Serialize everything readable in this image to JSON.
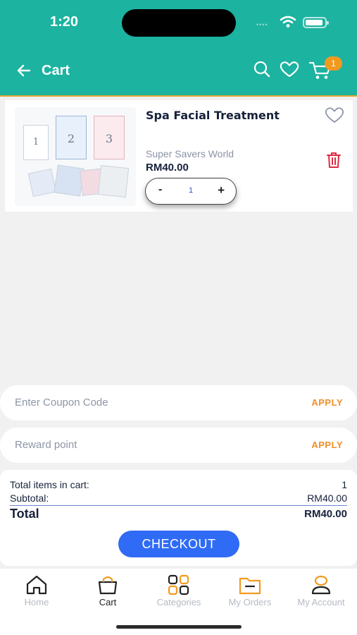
{
  "status_bar": {
    "time": "1:20",
    "signal": "••••"
  },
  "header": {
    "title": "Cart",
    "cart_badge": "1",
    "brand_color": "#1cb3a0",
    "accent_color": "#f29a1f"
  },
  "cart_item": {
    "name": "Spa Facial Treatment",
    "seller": "Super Savers World",
    "price": "RM40.00",
    "quantity": "1",
    "minus_label": "-",
    "plus_label": "+"
  },
  "coupon": {
    "placeholder": "Enter Coupon Code",
    "apply_label": "APPLY"
  },
  "reward": {
    "placeholder": "Reward point",
    "apply_label": "APPLY"
  },
  "summary": {
    "items_label": "Total items in cart:",
    "items_value": "1",
    "subtotal_label": "Subtotal:",
    "subtotal_value": "RM40.00",
    "total_label": "Total",
    "total_value": "RM40.00"
  },
  "checkout_label": "CHECKOUT",
  "bottom_nav": [
    {
      "label": "Home",
      "icon": "home-icon"
    },
    {
      "label": "Cart",
      "icon": "bag-icon",
      "active": true
    },
    {
      "label": "Categories",
      "icon": "grid-icon"
    },
    {
      "label": "My Orders",
      "icon": "folder-icon"
    },
    {
      "label": "My Account",
      "icon": "user-icon"
    }
  ]
}
